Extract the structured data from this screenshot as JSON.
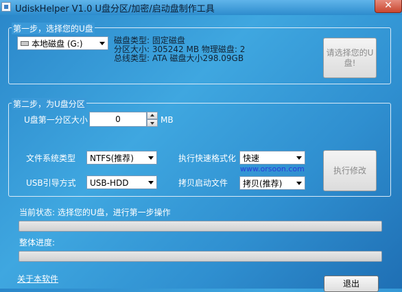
{
  "window": {
    "title": "UdiskHelper V1.0  U盘分区/加密/启动盘制作工具",
    "close_label": "✕"
  },
  "step1": {
    "label": "第一步，选择您的U盘",
    "drive_select": {
      "value": "本地磁盘 (G:)",
      "icon": "usb-drive-icon"
    },
    "info": {
      "line1": "磁盘类型: 固定磁盘",
      "line2": "分区大小: 305242 MB  物理磁盘: 2",
      "line3": "总线类型: ATA   磁盘大小298.09GB"
    },
    "select_button": {
      "line1": "请选择您的U",
      "line2": "盘!"
    }
  },
  "step2": {
    "label": "第二步，为U盘分区",
    "partition_size": {
      "label": "U盘第一分区大小",
      "value": "0",
      "unit": "MB"
    },
    "filesystem": {
      "label": "文件系统类型",
      "value": "NTFS(推荐)"
    },
    "quick_format": {
      "label": "执行快速格式化",
      "value": "快速"
    },
    "boot_mode": {
      "label": "USB引导方式",
      "value": "USB-HDD"
    },
    "copy_boot": {
      "label": "拷贝启动文件",
      "value": "拷贝(推荐)"
    },
    "execute_button": "执行修改",
    "watermark": "www.orsoon.com"
  },
  "status": {
    "current_label": "当前状态: 选择您的U盘，进行第一步操作",
    "current_progress": 0,
    "overall_label": "整体进度:",
    "overall_progress": 0
  },
  "footer": {
    "about_link": "关于本软件",
    "exit_button": "退出"
  }
}
